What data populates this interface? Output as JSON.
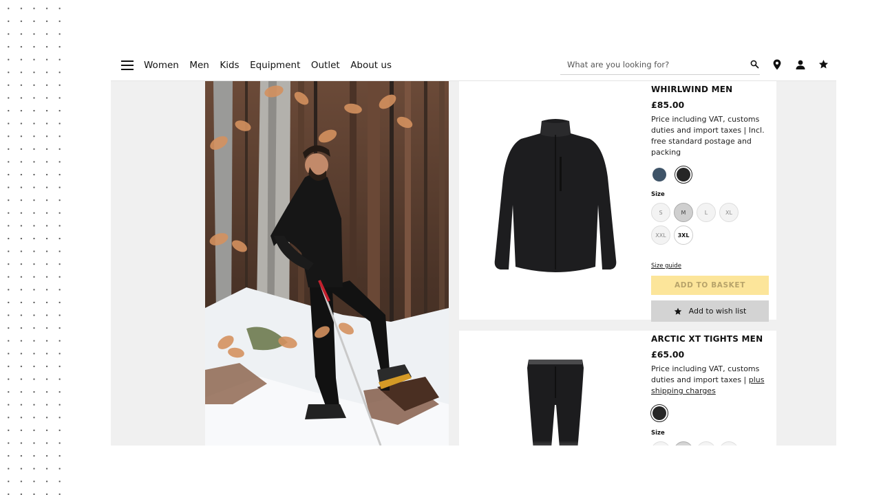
{
  "nav": {
    "items": [
      "Women",
      "Men",
      "Kids",
      "Equipment",
      "Outlet",
      "About us"
    ]
  },
  "search": {
    "placeholder": "What are you looking for?"
  },
  "icons": {
    "menu": "hamburger-menu-icon",
    "search": "search-icon",
    "store_locator": "location-pin-icon",
    "account": "user-icon",
    "wishlist": "star-icon"
  },
  "products": [
    {
      "title": "WHIRLWIND MEN",
      "price": "£85.00",
      "vat_text": "Price including VAT, customs duties and import taxes | Incl. free standard postage and packing",
      "colors": [
        "#3f5468",
        "#262626"
      ],
      "selected_color": "#262626",
      "size_label": "Size",
      "sizes": [
        "S",
        "M",
        "L",
        "XL",
        "XXL",
        "3XL"
      ],
      "selected_size": "M",
      "available_sizes": [
        "3XL"
      ],
      "size_guide": "Size guide",
      "add_to_basket": "ADD TO BASKET",
      "add_to_wishlist": "Add to wish list"
    },
    {
      "title": "ARCTIC XT TIGHTS MEN",
      "price": "£65.00",
      "vat_text_prefix": "Price including VAT, customs duties and import taxes | ",
      "vat_link": "plus shipping charges",
      "colors": [
        "#262626"
      ],
      "selected_color": "#262626",
      "size_label": "Size"
    }
  ],
  "colors": {
    "basket_bg": "#fce59a",
    "basket_text": "#b7a36a",
    "wishlist_bg": "#d3d3d3",
    "page_bg": "#f0f0f0"
  }
}
